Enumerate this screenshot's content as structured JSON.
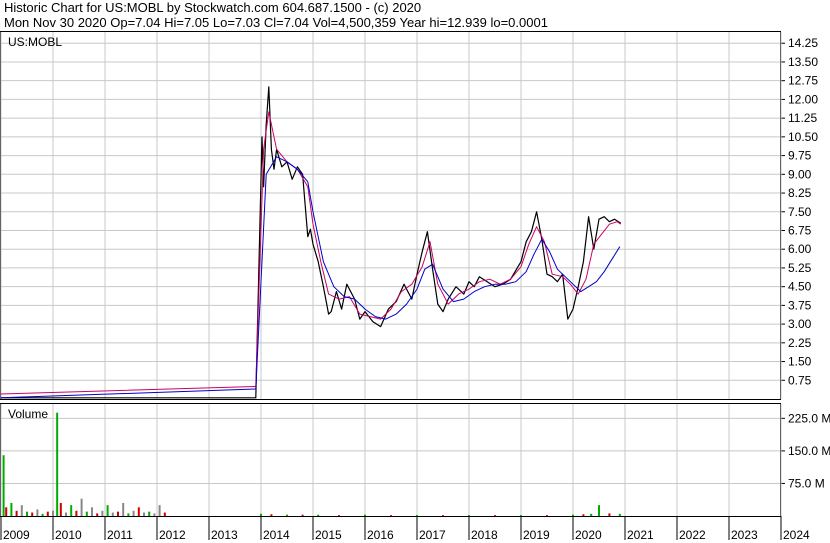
{
  "header": {
    "line1": "Historic Chart for US:MOBL by Stockwatch.com 604.687.1500 - (c) 2020",
    "line2": "Mon Nov 30 2020   Op=7.04   Hi=7.05   Lo=7.03   Cl=7.04   Vol=4,500,359   Year hi=12.939   lo=0.0001"
  },
  "chart_data": [
    {
      "type": "line",
      "title": "US:MOBL",
      "xlabel": "",
      "ylabel": "",
      "x_ticks": [
        "2009",
        "2010",
        "2011",
        "2012",
        "2013",
        "2014",
        "2015",
        "2016",
        "2017",
        "2018",
        "2019",
        "2020",
        "2021",
        "2022",
        "2023",
        "2024"
      ],
      "y_ticks": [
        "14.25",
        "13.50",
        "12.75",
        "12.00",
        "11.25",
        "10.50",
        "9.75",
        "9.00",
        "8.25",
        "7.50",
        "6.75",
        "6.00",
        "5.25",
        "4.50",
        "3.75",
        "3.00",
        "2.25",
        "1.50",
        "0.75"
      ],
      "ylim": [
        0,
        14.7
      ],
      "grid": true,
      "series": [
        {
          "color": "#000000",
          "x": [
            2009.0,
            2013.9,
            2014.02,
            2014.05,
            2014.1,
            2014.15,
            2014.2,
            2014.25,
            2014.3,
            2014.4,
            2014.5,
            2014.6,
            2014.7,
            2014.8,
            2014.9,
            2014.95,
            2015.0,
            2015.1,
            2015.2,
            2015.3,
            2015.35,
            2015.45,
            2015.55,
            2015.65,
            2015.8,
            2015.9,
            2016.0,
            2016.15,
            2016.3,
            2016.45,
            2016.6,
            2016.75,
            2016.9,
            2017.0,
            2017.1,
            2017.2,
            2017.3,
            2017.4,
            2017.5,
            2017.6,
            2017.75,
            2017.9,
            2018.0,
            2018.1,
            2018.2,
            2018.35,
            2018.5,
            2018.65,
            2018.8,
            2019.0,
            2019.1,
            2019.2,
            2019.3,
            2019.4,
            2019.5,
            2019.6,
            2019.7,
            2019.8,
            2019.9,
            2020.0,
            2020.1,
            2020.2,
            2020.3,
            2020.4,
            2020.5,
            2020.6,
            2020.7,
            2020.8,
            2020.92
          ],
          "values": [
            0.05,
            0.05,
            10.5,
            8.5,
            11.0,
            12.5,
            10.0,
            9.2,
            10.0,
            9.3,
            9.5,
            8.8,
            9.3,
            9.0,
            6.5,
            6.8,
            6.2,
            5.5,
            4.5,
            3.4,
            3.5,
            4.3,
            3.6,
            4.6,
            4.0,
            3.2,
            3.5,
            3.1,
            2.9,
            3.6,
            3.9,
            4.6,
            4.0,
            5.0,
            5.9,
            6.7,
            5.2,
            3.8,
            3.5,
            4.0,
            4.5,
            4.2,
            4.7,
            4.5,
            4.9,
            4.7,
            4.5,
            4.6,
            4.8,
            5.5,
            6.3,
            6.7,
            7.5,
            6.4,
            5.0,
            4.9,
            4.7,
            5.0,
            3.2,
            3.6,
            4.5,
            5.5,
            7.3,
            6.0,
            7.2,
            7.3,
            7.1,
            7.2,
            7.04
          ]
        },
        {
          "color": "#cc0066",
          "x": [
            2009.0,
            2013.9,
            2014.05,
            2014.15,
            2014.3,
            2014.5,
            2014.7,
            2014.9,
            2015.0,
            2015.15,
            2015.3,
            2015.5,
            2015.7,
            2015.9,
            2016.1,
            2016.3,
            2016.5,
            2016.7,
            2016.9,
            2017.1,
            2017.25,
            2017.4,
            2017.6,
            2017.8,
            2018.0,
            2018.2,
            2018.4,
            2018.6,
            2018.8,
            2019.0,
            2019.15,
            2019.3,
            2019.45,
            2019.6,
            2019.8,
            2019.95,
            2020.1,
            2020.25,
            2020.4,
            2020.55,
            2020.7,
            2020.85,
            2020.92
          ],
          "values": [
            0.2,
            0.5,
            10.0,
            11.5,
            10.0,
            9.5,
            9.2,
            8.5,
            7.0,
            5.5,
            4.2,
            4.0,
            4.1,
            3.4,
            3.3,
            3.2,
            3.6,
            4.3,
            4.6,
            5.3,
            6.3,
            4.6,
            3.8,
            4.2,
            4.4,
            4.7,
            4.8,
            4.6,
            4.8,
            5.3,
            6.2,
            6.9,
            6.3,
            5.0,
            4.9,
            4.6,
            4.2,
            4.8,
            6.2,
            6.6,
            7.0,
            7.1,
            7.0
          ]
        },
        {
          "color": "#0000cc",
          "x": [
            2009.0,
            2013.9,
            2014.1,
            2014.3,
            2014.5,
            2014.7,
            2014.9,
            2015.0,
            2015.2,
            2015.4,
            2015.6,
            2015.8,
            2016.0,
            2016.2,
            2016.4,
            2016.6,
            2016.8,
            2017.0,
            2017.15,
            2017.3,
            2017.5,
            2017.7,
            2017.9,
            2018.1,
            2018.3,
            2018.5,
            2018.7,
            2018.9,
            2019.1,
            2019.25,
            2019.4,
            2019.55,
            2019.7,
            2019.85,
            2020.0,
            2020.15,
            2020.3,
            2020.45,
            2020.6,
            2020.75,
            2020.9
          ],
          "values": [
            0.05,
            0.4,
            9.0,
            9.7,
            9.5,
            9.2,
            8.7,
            7.5,
            5.5,
            4.5,
            4.1,
            4.0,
            3.6,
            3.3,
            3.2,
            3.4,
            3.8,
            4.4,
            5.2,
            5.4,
            4.4,
            3.9,
            4.0,
            4.3,
            4.5,
            4.6,
            4.6,
            4.7,
            5.1,
            5.8,
            6.4,
            5.9,
            5.2,
            4.9,
            4.6,
            4.3,
            4.5,
            4.7,
            5.1,
            5.6,
            6.1
          ]
        }
      ]
    },
    {
      "type": "bar",
      "title": "Volume",
      "xlabel": "",
      "ylabel": "",
      "y_ticks": [
        "225.0 M",
        "150.0 M",
        "75.0 M"
      ],
      "ylim": [
        0,
        258
      ],
      "grid": true,
      "colors": {
        "up": "#00aa00",
        "down": "#cc0000",
        "flat": "#888888"
      },
      "x": [
        2009.05,
        2009.1,
        2009.2,
        2009.3,
        2009.4,
        2009.5,
        2009.6,
        2009.7,
        2009.8,
        2009.9,
        2010.0,
        2010.08,
        2010.15,
        2010.25,
        2010.35,
        2010.45,
        2010.55,
        2010.65,
        2010.75,
        2010.85,
        2010.95,
        2011.05,
        2011.15,
        2011.25,
        2011.35,
        2011.45,
        2011.55,
        2011.65,
        2011.75,
        2011.85,
        2011.95,
        2012.05,
        2012.15,
        2014.0,
        2014.2,
        2014.5,
        2014.8,
        2015.1,
        2015.5,
        2016.0,
        2016.5,
        2017.0,
        2017.5,
        2018.0,
        2018.5,
        2019.0,
        2019.5,
        2020.0,
        2020.2,
        2020.35,
        2020.5,
        2020.7,
        2020.9
      ],
      "values": [
        140,
        20,
        30,
        12,
        25,
        10,
        8,
        15,
        5,
        10,
        12,
        238,
        30,
        8,
        25,
        12,
        40,
        10,
        20,
        6,
        12,
        25,
        8,
        10,
        30,
        6,
        12,
        20,
        8,
        10,
        6,
        25,
        8,
        5,
        4,
        3,
        3,
        3,
        2,
        3,
        2,
        2,
        2,
        2,
        2,
        2,
        2,
        3,
        4,
        5,
        25,
        6,
        5
      ],
      "bar_colors": [
        "up",
        "down",
        "up",
        "down",
        "flat",
        "up",
        "down",
        "flat",
        "up",
        "down",
        "flat",
        "up",
        "down",
        "flat",
        "up",
        "down",
        "flat",
        "up",
        "flat",
        "down",
        "flat",
        "up",
        "flat",
        "down",
        "flat",
        "up",
        "flat",
        "down",
        "flat",
        "up",
        "flat",
        "flat",
        "down",
        "up",
        "down",
        "up",
        "down",
        "up",
        "down",
        "up",
        "down",
        "up",
        "down",
        "up",
        "down",
        "up",
        "down",
        "up",
        "down",
        "up",
        "up",
        "down",
        "up"
      ]
    }
  ]
}
